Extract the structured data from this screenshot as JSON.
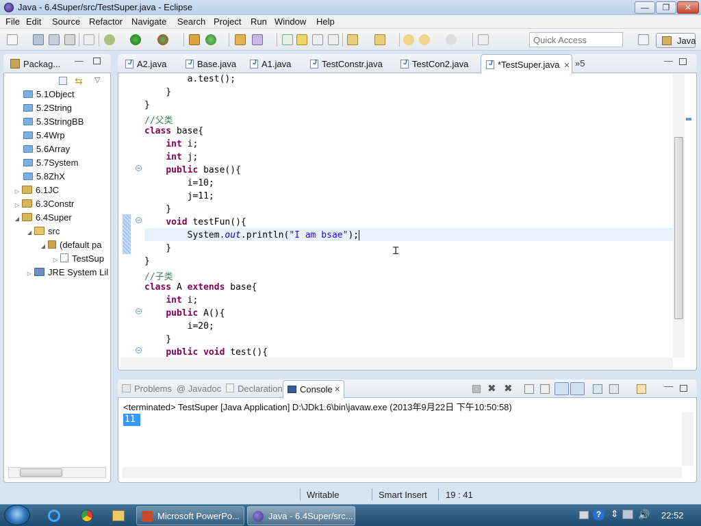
{
  "window": {
    "title": "Java - 6.4Super/src/TestSuper.java - Eclipse",
    "min": "—",
    "max": "❐",
    "close": "✕"
  },
  "menu": [
    "File",
    "Edit",
    "Source",
    "Refactor",
    "Navigate",
    "Search",
    "Project",
    "Run",
    "Window",
    "Help"
  ],
  "toolbar": {
    "quick_access_placeholder": "Quick Access",
    "perspective": "Java"
  },
  "package_explorer": {
    "title": "Packag...",
    "items": [
      {
        "label": "5.1Object"
      },
      {
        "label": "5.2String"
      },
      {
        "label": "5.3StringBB"
      },
      {
        "label": "5.4Wrp"
      },
      {
        "label": "5.6Array"
      },
      {
        "label": "5.7System"
      },
      {
        "label": "5.8ZhX"
      },
      {
        "label": "6.1JC"
      },
      {
        "label": "6.3Constr"
      },
      {
        "label": "6.4Super"
      },
      {
        "label": "src"
      },
      {
        "label": "(default pa"
      },
      {
        "label": "TestSup"
      },
      {
        "label": "JRE System Lil"
      }
    ]
  },
  "editor": {
    "tabs": [
      {
        "label": "A2.java"
      },
      {
        "label": "Base.java"
      },
      {
        "label": "A1.java"
      },
      {
        "label": "TestConstr.java"
      },
      {
        "label": "TestCon2.java"
      },
      {
        "label": "*TestSuper.java"
      }
    ],
    "overflow": "»5",
    "active_line": "System.out.println(\"I am bsae\");"
  },
  "console": {
    "tabs": [
      {
        "label": "Problems"
      },
      {
        "label": "@ Javadoc"
      },
      {
        "label": "Declaration"
      },
      {
        "label": "Console"
      }
    ],
    "header": "<terminated> TestSuper [Java Application] D:\\JDk1.6\\bin\\javaw.exe (2013年9月22日 下午10:50:58)",
    "output": "11"
  },
  "status": {
    "writable": "Writable",
    "insert_mode": "Smart Insert",
    "position": "19 : 41"
  },
  "taskbar": {
    "items": [
      {
        "label": "Microsoft PowerPo..."
      },
      {
        "label": "Java - 6.4Super/src..."
      }
    ],
    "clock": "22:52"
  },
  "colors": {
    "keyword": "#7f0055",
    "comment": "#3f7f5f",
    "string": "#2a00ff",
    "static_field": "#0000c0",
    "selection": "#3399ff",
    "taskbar": "#1f4d71"
  }
}
